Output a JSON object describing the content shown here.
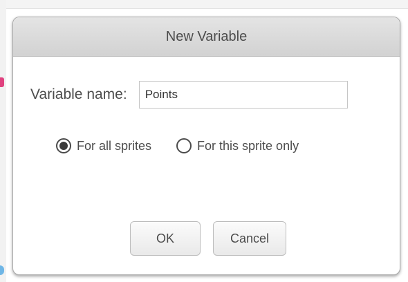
{
  "dialog": {
    "title": "New Variable",
    "name_label": "Variable name:",
    "name_value": "Points",
    "scope_options": [
      {
        "label": "For all sprites",
        "selected": true
      },
      {
        "label": "For this sprite only",
        "selected": false
      }
    ],
    "ok_label": "OK",
    "cancel_label": "Cancel"
  },
  "colors": {
    "background_marker_pink": "#e0427f",
    "background_marker_blue": "#6fb6e6"
  }
}
